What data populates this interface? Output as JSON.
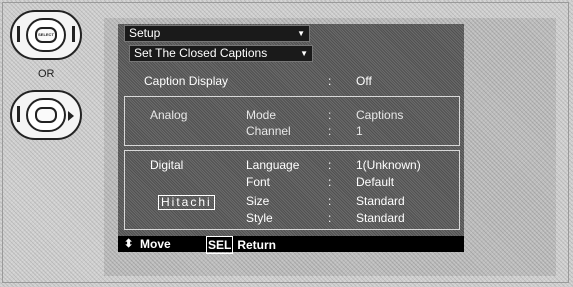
{
  "remote": {
    "select_button_label": "SELECT",
    "or_label": "OR"
  },
  "menu": {
    "tab_setup": "Setup",
    "tab_closed_captions": "Set The Closed Captions",
    "caption_display": {
      "label": "Caption Display",
      "sep": ":",
      "value": "Off"
    },
    "analog": {
      "section": "Analog",
      "rows": [
        {
          "label": "Mode",
          "sep": ":",
          "value": "Captions"
        },
        {
          "label": "Channel",
          "sep": ":",
          "value": "1"
        }
      ]
    },
    "digital": {
      "section": "Digital",
      "brand": "Hitachi",
      "rows": [
        {
          "label": "Language",
          "sep": ":",
          "value": "1(Unknown)"
        },
        {
          "label": "Font",
          "sep": ":",
          "value": "Default"
        },
        {
          "label": "Size",
          "sep": ":",
          "value": "Standard"
        },
        {
          "label": "Style",
          "sep": ":",
          "value": "Standard"
        }
      ]
    },
    "footer": {
      "move_label": "Move",
      "sel_key": "SEL",
      "return_label": "Return"
    }
  }
}
